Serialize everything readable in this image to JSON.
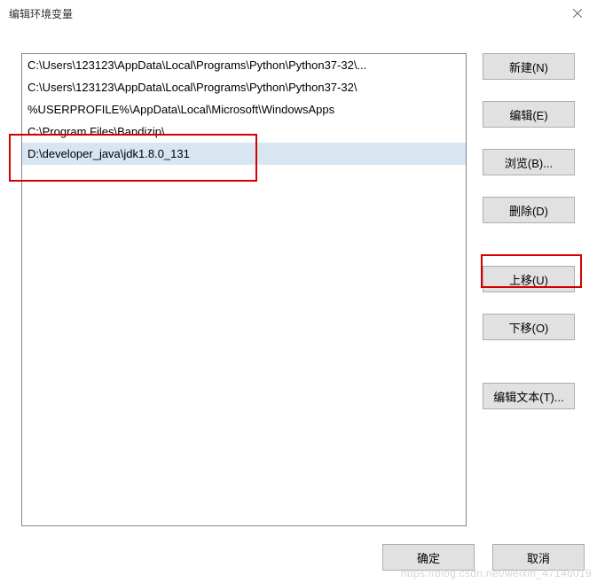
{
  "title": "编辑环境变量",
  "list": {
    "items": [
      "C:\\Users\\123123\\AppData\\Local\\Programs\\Python\\Python37-32\\...",
      "C:\\Users\\123123\\AppData\\Local\\Programs\\Python\\Python37-32\\",
      "%USERPROFILE%\\AppData\\Local\\Microsoft\\WindowsApps",
      "C:\\Program Files\\Bandizip\\",
      "D:\\developer_java\\jdk1.8.0_131"
    ],
    "selectedIndex": 4
  },
  "buttons": {
    "new": "新建(N)",
    "edit": "编辑(E)",
    "browse": "浏览(B)...",
    "delete": "删除(D)",
    "moveUp": "上移(U)",
    "moveDown": "下移(O)",
    "editText": "编辑文本(T)...",
    "ok": "确定",
    "cancel": "取消"
  },
  "watermark": "https://blog.csdn.net/weixin_47146019"
}
